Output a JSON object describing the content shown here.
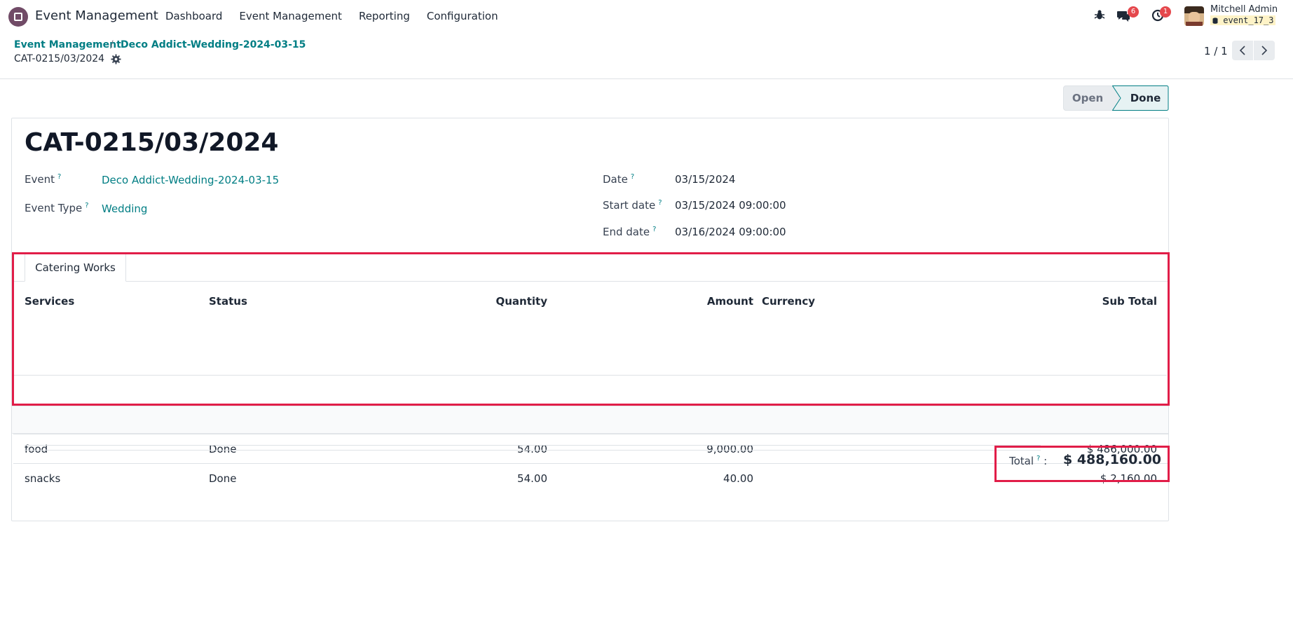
{
  "app": {
    "name": "Event Management"
  },
  "menu": {
    "items": [
      "Dashboard",
      "Event Management",
      "Reporting",
      "Configuration"
    ]
  },
  "systray": {
    "chat_count": "6",
    "activity_count": "1",
    "user_name": "Mitchell Admin",
    "database": "event_17_3"
  },
  "breadcrumb": {
    "root": "Event Management",
    "separator": "/",
    "event": "Deco Addict-Wedding-2024-03-15",
    "current": "CAT-0215/03/2024"
  },
  "pager": {
    "value": "1 / 1"
  },
  "status": {
    "stages": [
      "Open",
      "Done"
    ],
    "active": "Done"
  },
  "form": {
    "title": "CAT-0215/03/2024",
    "event_label": "Event",
    "event_value": "Deco Addict-Wedding-2024-03-15",
    "event_type_label": "Event Type",
    "event_type_value": "Wedding",
    "date_label": "Date",
    "date_value": "03/15/2024",
    "start_label": "Start date",
    "start_value": "03/15/2024 09:00:00",
    "end_label": "End date",
    "end_value": "03/16/2024 09:00:00",
    "help_mark": "?"
  },
  "tabs": [
    {
      "label": "Catering Works"
    }
  ],
  "table": {
    "columns": [
      "Services",
      "Status",
      "Quantity",
      "Amount",
      "Currency",
      "Sub Total"
    ],
    "rows": [
      [
        "food",
        "Done",
        "54.00",
        "9,000.00",
        "",
        "$ 486,000.00"
      ],
      [
        "snacks",
        "Done",
        "54.00",
        "40.00",
        "",
        "$ 2,160.00"
      ]
    ]
  },
  "total": {
    "label": "Total",
    "suffix": ":",
    "value": "$ 488,160.00"
  },
  "colors": {
    "accent": "#017e84",
    "brand": "#714b67",
    "highlight": "#e11d48",
    "badge": "#e5484d"
  }
}
